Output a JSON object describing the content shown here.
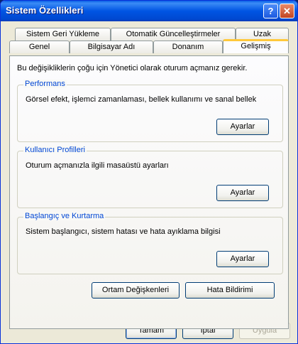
{
  "window": {
    "title": "Sistem Özellikleri"
  },
  "titlebar": {
    "help_label": "?",
    "close_label": "✕"
  },
  "tabs": {
    "row1": [
      {
        "label": "Sistem Geri Yükleme"
      },
      {
        "label": "Otomatik Güncelleştirmeler"
      },
      {
        "label": "Uzak"
      }
    ],
    "row2": [
      {
        "label": "Genel"
      },
      {
        "label": "Bilgisayar Adı"
      },
      {
        "label": "Donanım"
      },
      {
        "label": "Gelişmiş",
        "active": true
      }
    ]
  },
  "panel": {
    "intro": "Bu değişikliklerin çoğu için Yönetici olarak oturum açmanız gerekir.",
    "groups": [
      {
        "title": "Performans",
        "text": "Görsel efekt, işlemci zamanlaması, bellek kullanımı ve sanal bellek",
        "button": "Ayarlar"
      },
      {
        "title": "Kullanıcı Profilleri",
        "text": "Oturum açmanızla ilgili masaüstü ayarları",
        "button": "Ayarlar"
      },
      {
        "title": "Başlangıç ve Kurtarma",
        "text": "Sistem başlangıcı, sistem hatası ve hata ayıklama bilgisi",
        "button": "Ayarlar"
      }
    ],
    "env_button": "Ortam Değişkenleri",
    "error_report_button": "Hata Bildirimi"
  },
  "footer": {
    "ok": "Tamam",
    "cancel": "İptal",
    "apply": "Uygula"
  },
  "colors": {
    "titlebar": "#0054e3",
    "group_title": "#0046d5",
    "active_tab_accent": "#ffc83c"
  }
}
